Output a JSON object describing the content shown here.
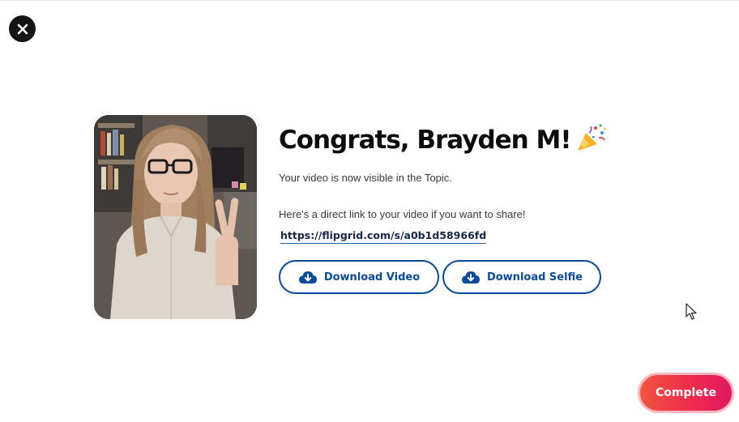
{
  "header": {
    "close_icon": "close-icon"
  },
  "selfie": {
    "description": "selfie-thumbnail"
  },
  "congrats": {
    "title": "Congrats, Brayden M!",
    "title_icon": "party-popper-icon",
    "status": "Your video is now visible in the Topic.",
    "share_prompt": "Here's a direct link to your video if you want to share!",
    "share_link": "https://flipgrid.com/s/a0b1d58966fd"
  },
  "actions": {
    "download_video_label": "Download Video",
    "download_selfie_label": "Download Selfie",
    "download_icon": "cloud-download-icon",
    "complete_label": "Complete"
  },
  "colors": {
    "primary_blue": "#0b4b9b",
    "complete_start": "#f2543e",
    "complete_end": "#e11962",
    "close_bg": "#141414"
  }
}
